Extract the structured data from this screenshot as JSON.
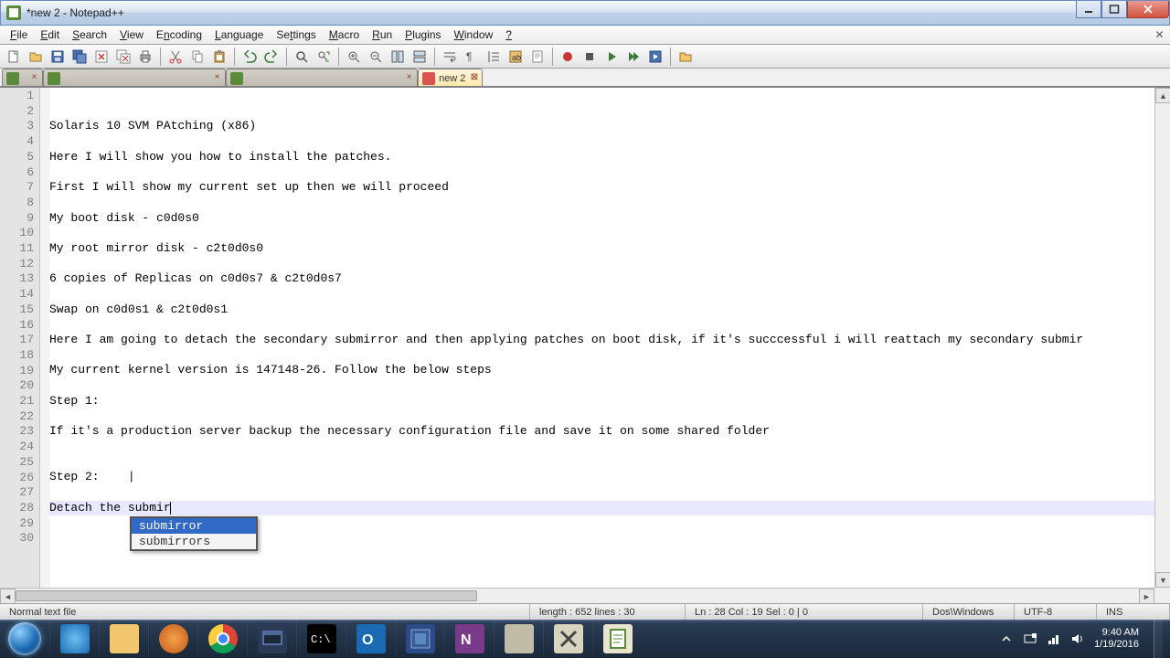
{
  "window": {
    "title": "*new 2 - Notepad++"
  },
  "menus": [
    "File",
    "Edit",
    "Search",
    "View",
    "Encoding",
    "Language",
    "Settings",
    "Macro",
    "Run",
    "Plugins",
    "Window",
    "?"
  ],
  "tabs": [
    {
      "label": "",
      "active": false
    },
    {
      "label": "",
      "active": false
    },
    {
      "label": "",
      "active": false
    },
    {
      "label": "new 2",
      "active": true
    }
  ],
  "editor": {
    "lines": [
      "",
      "",
      "Solaris 10 SVM PAtching (x86)",
      "",
      "Here I will show you how to install the patches.",
      "",
      "First I will show my current set up then we will proceed",
      "",
      "My boot disk - c0d0s0",
      "",
      "My root mirror disk - c2t0d0s0",
      "",
      "6 copies of Replicas on c0d0s7 & c2t0d0s7",
      "",
      "Swap on c0d0s1 & c2t0d0s1",
      "",
      "Here I am going to detach the secondary submirror and then applying patches on boot disk, if it's succcessful i will reattach my secondary submir",
      "",
      "My current kernel version is 147148-26. Follow the below steps",
      "",
      "Step 1:",
      "",
      "If it's a production server backup the necessary configuration file and save it on some shared folder",
      "",
      "",
      "Step 2:    |",
      "",
      "Detach the submir",
      "",
      ""
    ],
    "current_line_index": 27,
    "autocomplete": {
      "items": [
        "submirror",
        "submirrors"
      ],
      "selected": 0
    }
  },
  "status": {
    "filetype": "Normal text file",
    "length": "length : 652    lines : 30",
    "position": "Ln : 28    Col : 19    Sel : 0 | 0",
    "eol": "Dos\\Windows",
    "encoding": "UTF-8",
    "insmode": "INS"
  },
  "tray": {
    "time": "9:40 AM",
    "date": "1/19/2016"
  }
}
